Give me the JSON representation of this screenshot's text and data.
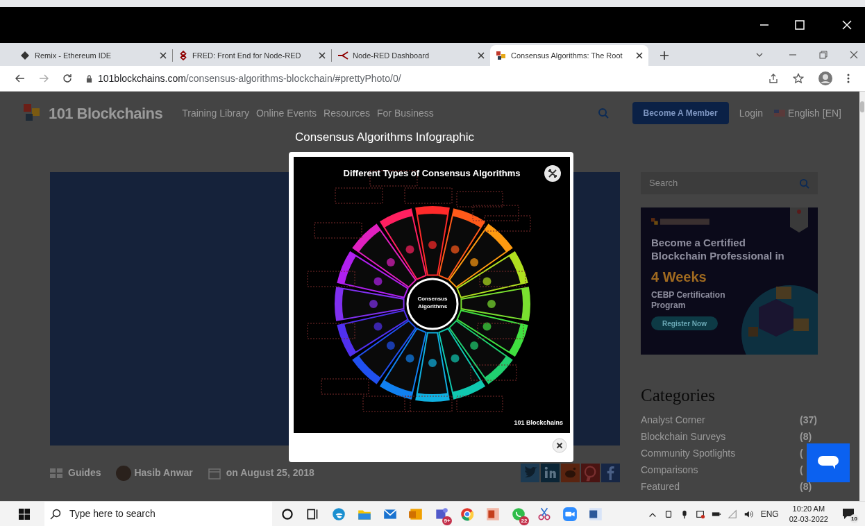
{
  "browser": {
    "tabs": [
      {
        "title": "Remix - Ethereum IDE",
        "selected": false
      },
      {
        "title": "FRED: Front End for Node-RED",
        "selected": false
      },
      {
        "title": "Node-RED Dashboard",
        "selected": false
      },
      {
        "title": "Consensus Algorithms: The Root",
        "selected": true
      }
    ],
    "url_host": "101blockchains.com",
    "url_path": "/consensus-algorithms-blockchain/#prettyPhoto/0/"
  },
  "site_header": {
    "logo": "101 Blockchains",
    "nav": [
      "Training Library",
      "Online Events",
      "Resources",
      "For Business"
    ],
    "cta": "Become A Member",
    "login": "Login",
    "language": "English [EN]"
  },
  "lightbox": {
    "title": "Consensus Algorithms Infographic",
    "infographic": {
      "heading": "Different Types of Consensus Algorithms",
      "center": "Consensus Algorithms",
      "brand": "101 Blockchains"
    }
  },
  "post_meta": {
    "category": "Guides",
    "author": "Hasib Anwar",
    "date": "on August 25, 2018"
  },
  "sidebar": {
    "search_placeholder": "Search",
    "ad": {
      "headline": "Become a Certified Blockchain Professional in",
      "highlight": "4 Weeks",
      "program": "CEBP Certification Program",
      "button": "Register Now"
    },
    "categories_title": "Categories",
    "categories": [
      {
        "name": "Analyst Corner",
        "count": "(37)"
      },
      {
        "name": "Blockchain Surveys",
        "count": "(8)"
      },
      {
        "name": "Community Spotlights",
        "count": "("
      },
      {
        "name": "Comparisons",
        "count": "("
      },
      {
        "name": "Featured",
        "count": "(8)"
      }
    ]
  },
  "taskbar": {
    "search_placeholder": "Type here to search",
    "apps": [
      {
        "kind": "cortana"
      },
      {
        "kind": "taskview"
      },
      {
        "kind": "edge"
      },
      {
        "kind": "explorer"
      },
      {
        "kind": "mail"
      },
      {
        "kind": "outlook"
      },
      {
        "kind": "teams",
        "badge": "9+"
      },
      {
        "kind": "chrome"
      },
      {
        "kind": "powerpoint"
      },
      {
        "kind": "whatsapp",
        "badge": "22"
      },
      {
        "kind": "snip"
      },
      {
        "kind": "zoom"
      },
      {
        "kind": "word"
      }
    ],
    "language": "ENG",
    "time": "10:20 AM",
    "date": "02-03-2022",
    "notifications": "10"
  }
}
